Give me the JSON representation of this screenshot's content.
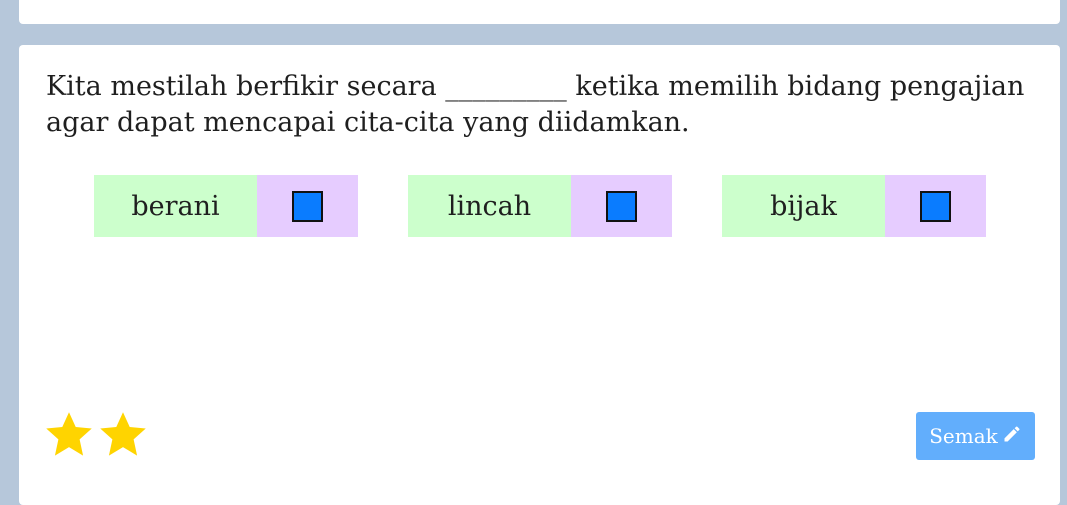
{
  "question": {
    "text": "Kita mestilah berfikir secara _________ ketika memilih bidang pengajian agar dapat mencapai cita-cita yang diidamkan."
  },
  "options": [
    {
      "label": "berani"
    },
    {
      "label": "lincah"
    },
    {
      "label": "bijak"
    }
  ],
  "rating": {
    "stars": 2
  },
  "footer": {
    "check_label": "Semak"
  },
  "colors": {
    "option_label_bg": "#ccffcc",
    "option_check_bg": "#e6ccff",
    "checkbox": "#0a7cff",
    "button": "#62aefc",
    "star": "#ffd400",
    "background": "#b6c7da"
  },
  "icons": {
    "star": "star-icon",
    "pencil": "pencil-icon"
  }
}
